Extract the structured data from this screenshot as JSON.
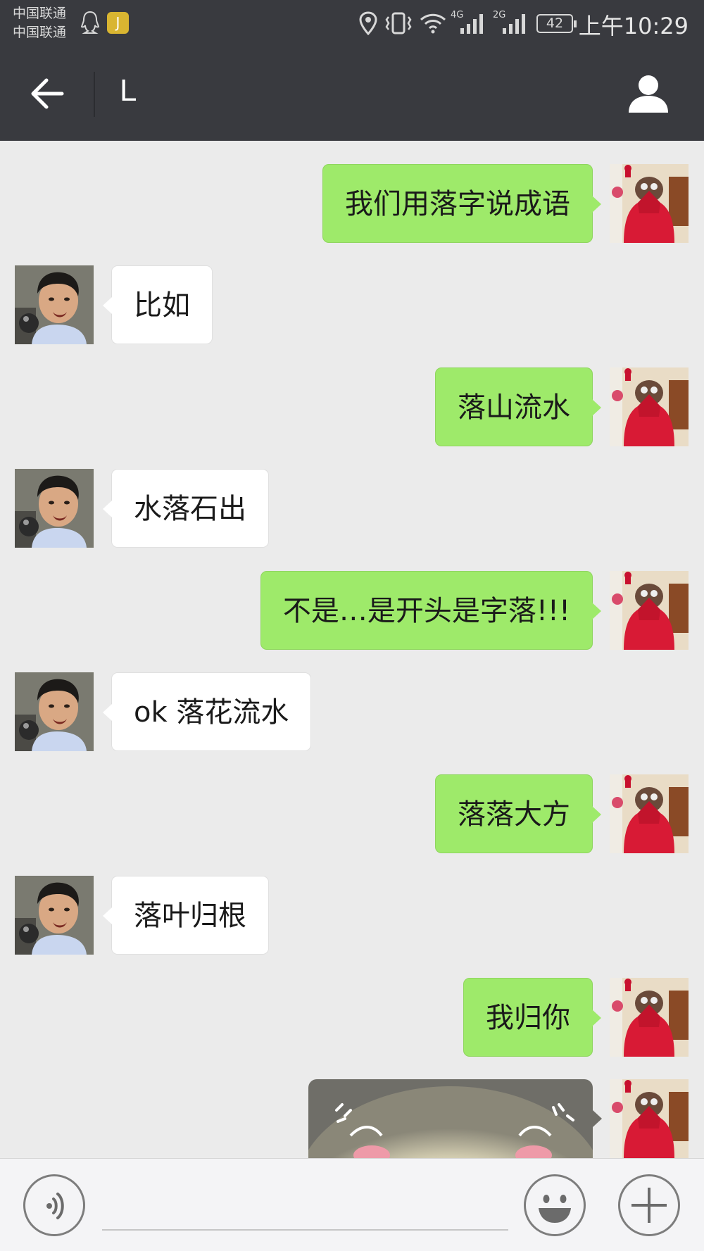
{
  "status_bar": {
    "carrier_1": "中国联通",
    "carrier_2": "中国联通",
    "app_badge": "J",
    "network_4g": "4G",
    "network_2g": "2G",
    "battery": "42",
    "time": "上午10:29"
  },
  "header": {
    "title": "L",
    "back_icon": "arrow-left-icon",
    "contact_icon": "person-icon"
  },
  "messages": [
    {
      "side": "right",
      "text": "我们用落字说成语"
    },
    {
      "side": "left",
      "text": "比如"
    },
    {
      "side": "right",
      "text": "落山流水"
    },
    {
      "side": "left",
      "text": "水落石出"
    },
    {
      "side": "right",
      "text": "不是…是开头是字落!!!"
    },
    {
      "side": "left",
      "text": "ok 落花流水"
    },
    {
      "side": "right",
      "text": "落落大方"
    },
    {
      "side": "left",
      "text": "落叶归根"
    },
    {
      "side": "right",
      "text": "我归你"
    },
    {
      "side": "right",
      "type": "sticker",
      "text": ""
    }
  ],
  "input_bar": {
    "text": "",
    "voice_icon": "voice-icon",
    "emoji_icon": "emoji-icon",
    "plus_icon": "plus-icon"
  },
  "colors": {
    "header_bg": "#393a3f",
    "chat_bg": "#ebebeb",
    "sent_bubble": "#9eea6a",
    "received_bubble": "#ffffff"
  }
}
